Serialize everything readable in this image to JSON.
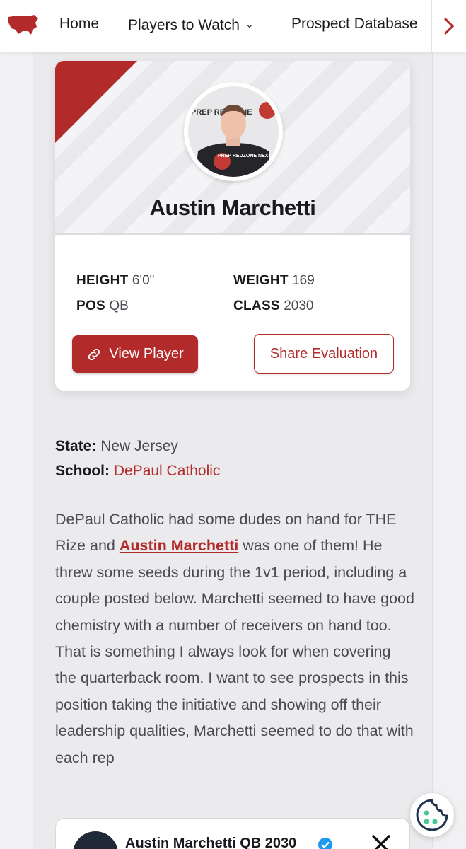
{
  "nav": {
    "logo_icon": "usa-map-icon",
    "items": [
      {
        "label": "Home"
      },
      {
        "label": "Players to Watch",
        "has_dropdown": true
      },
      {
        "label": "Prospect Database"
      }
    ],
    "more_icon": "chevron-right-icon"
  },
  "player": {
    "name": "Austin Marchetti",
    "stats": {
      "height_label": "HEIGHT",
      "height_value": "6'0\"",
      "weight_label": "WEIGHT",
      "weight_value": "169",
      "pos_label": "POS",
      "pos_value": "QB",
      "class_label": "CLASS",
      "class_value": "2030"
    },
    "view_button": "View Player",
    "share_button": "Share Evaluation",
    "shirt_text": "PREP REDZONE NEXT",
    "backdrop_text": "PREP REDZONE"
  },
  "meta": {
    "state_label": "State:",
    "state_value": "New Jersey",
    "school_label": "School:",
    "school_value": "DePaul Catholic"
  },
  "article": {
    "p1_before": "DePaul Catholic had some dudes on hand for THE Rize and ",
    "p1_link": "Austin Marchetti",
    "p1_after": " was one of them! He threw some seeds during the 1v1 period, including a couple posted below. Marchetti seemed to have good chemistry with a number of receivers on hand too. That is something I always look for when covering the quarterback room. I want to see prospects in this position taking the initiative and showing off their leadership qualities, Marchetti seemed to do that with each rep"
  },
  "embed": {
    "title": "Austin Marchetti QB 2030",
    "verified_icon": "verified-badge-icon",
    "platform_icon": "x-logo-icon"
  },
  "cookie_icon": "cookie-icon",
  "colors": {
    "brand_red": "#b32a2a",
    "text_dark": "#1a1a1e",
    "text_body": "#4a4a50"
  }
}
